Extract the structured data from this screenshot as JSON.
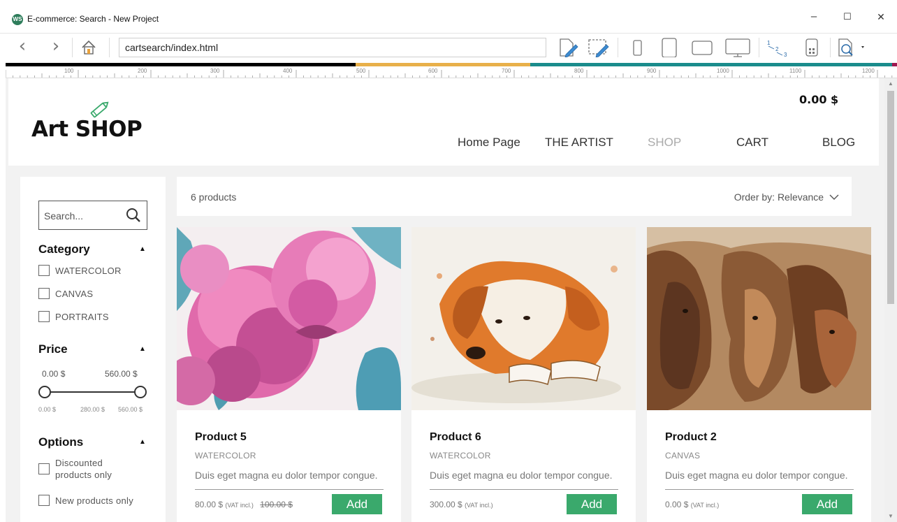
{
  "window": {
    "app_icon_text": "WS",
    "title": "E-commerce: Search - New Project",
    "minimize": "–",
    "maximize": "☐",
    "close": "✕"
  },
  "toolbar": {
    "back_glyph": "‹",
    "forward_glyph": "›",
    "url": "cartsearch/index.html",
    "icons": [
      "home-icon",
      "edit-page-icon",
      "edit-selection-icon",
      "phone-portrait-icon",
      "tablet-portrait-icon",
      "tablet-landscape-icon",
      "desktop-icon",
      "numbering-icon",
      "qr-code-icon",
      "preview-icon"
    ]
  },
  "ruler": {
    "labels": [
      "100",
      "200",
      "300",
      "400",
      "500",
      "600",
      "700",
      "800",
      "900",
      "1000",
      "1100",
      "1200"
    ],
    "colors": [
      "#000000",
      "#e8b04a",
      "#1a8c8c",
      "#a01850"
    ]
  },
  "header": {
    "logo_text": "Art SHOP",
    "cart_total": "0.00 $",
    "nav": [
      {
        "label": "Home Page",
        "active": false
      },
      {
        "label": "THE ARTIST",
        "active": false
      },
      {
        "label": "SHOP",
        "active": true
      },
      {
        "label": "CART",
        "active": false
      },
      {
        "label": "BLOG",
        "active": false
      }
    ]
  },
  "sidebar": {
    "search_placeholder": "Search...",
    "category": {
      "title": "Category",
      "arrow": "▲",
      "items": [
        "WATERCOLOR",
        "CANVAS",
        "PORTRAITS"
      ]
    },
    "price": {
      "title": "Price",
      "arrow": "▲",
      "min": "0.00 $",
      "max": "560.00 $",
      "scale": [
        "0.00 $",
        "280.00 $",
        "560.00 $"
      ]
    },
    "options": {
      "title": "Options",
      "arrow": "▲",
      "items": [
        "Discounted products only",
        "New products only"
      ]
    }
  },
  "results": {
    "count": "6 products",
    "order_by": "Order by: Relevance"
  },
  "products": [
    {
      "name": "Product 5",
      "category": "WATERCOLOR",
      "description": "Duis eget magna eu dolor tempor congue.",
      "price": "80.00 $",
      "vat": "(VAT incl.)",
      "old_price": "100.00 $",
      "button": "Add"
    },
    {
      "name": "Product 6",
      "category": "WATERCOLOR",
      "description": "Duis eget magna eu dolor tempor congue.",
      "price": "300.00 $",
      "vat": "(VAT incl.)",
      "old_price": "",
      "button": "Add"
    },
    {
      "name": "Product 2",
      "category": "CANVAS",
      "description": "Duis eget magna eu dolor tempor congue.",
      "price": "0.00 $",
      "vat": "(VAT incl.)",
      "old_price": "",
      "button": "Add"
    }
  ],
  "colors": {
    "accent_green": "#3aa96c",
    "page_bg": "#f2f2f2"
  }
}
